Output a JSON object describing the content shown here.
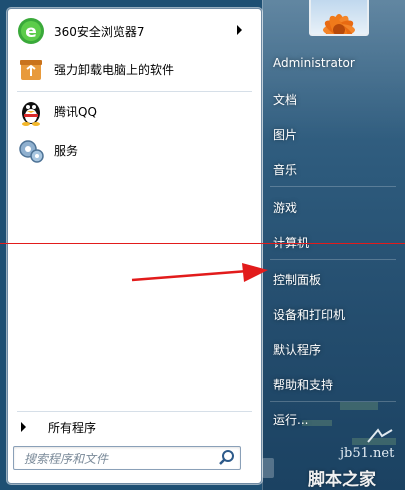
{
  "start_menu": {
    "pinned_programs": [
      {
        "label": "360安全浏览器7",
        "icon": "360-browser-icon",
        "has_submenu": true
      },
      {
        "label": "强力卸载电脑上的软件",
        "icon": "uninstaller-icon",
        "has_submenu": false
      }
    ],
    "recent_programs": [
      {
        "label": "腾讯QQ",
        "icon": "qq-penguin-icon"
      },
      {
        "label": "服务",
        "icon": "services-gear-icon"
      }
    ],
    "all_programs_label": "所有程序",
    "search": {
      "placeholder": "搜索程序和文件"
    },
    "right_items": [
      {
        "label": "Administrator"
      },
      {
        "label": "文档"
      },
      {
        "label": "图片"
      },
      {
        "label": "音乐"
      },
      {
        "label": "游戏"
      },
      {
        "label": "计算机"
      },
      {
        "label": "控制面板"
      },
      {
        "label": "设备和打印机"
      },
      {
        "label": "默认程序"
      },
      {
        "label": "帮助和支持"
      },
      {
        "label": "运行..."
      }
    ]
  },
  "annotation": {
    "color": "#e21b1b"
  },
  "watermark": {
    "site": "jb51.net",
    "text": "脚本之家"
  }
}
